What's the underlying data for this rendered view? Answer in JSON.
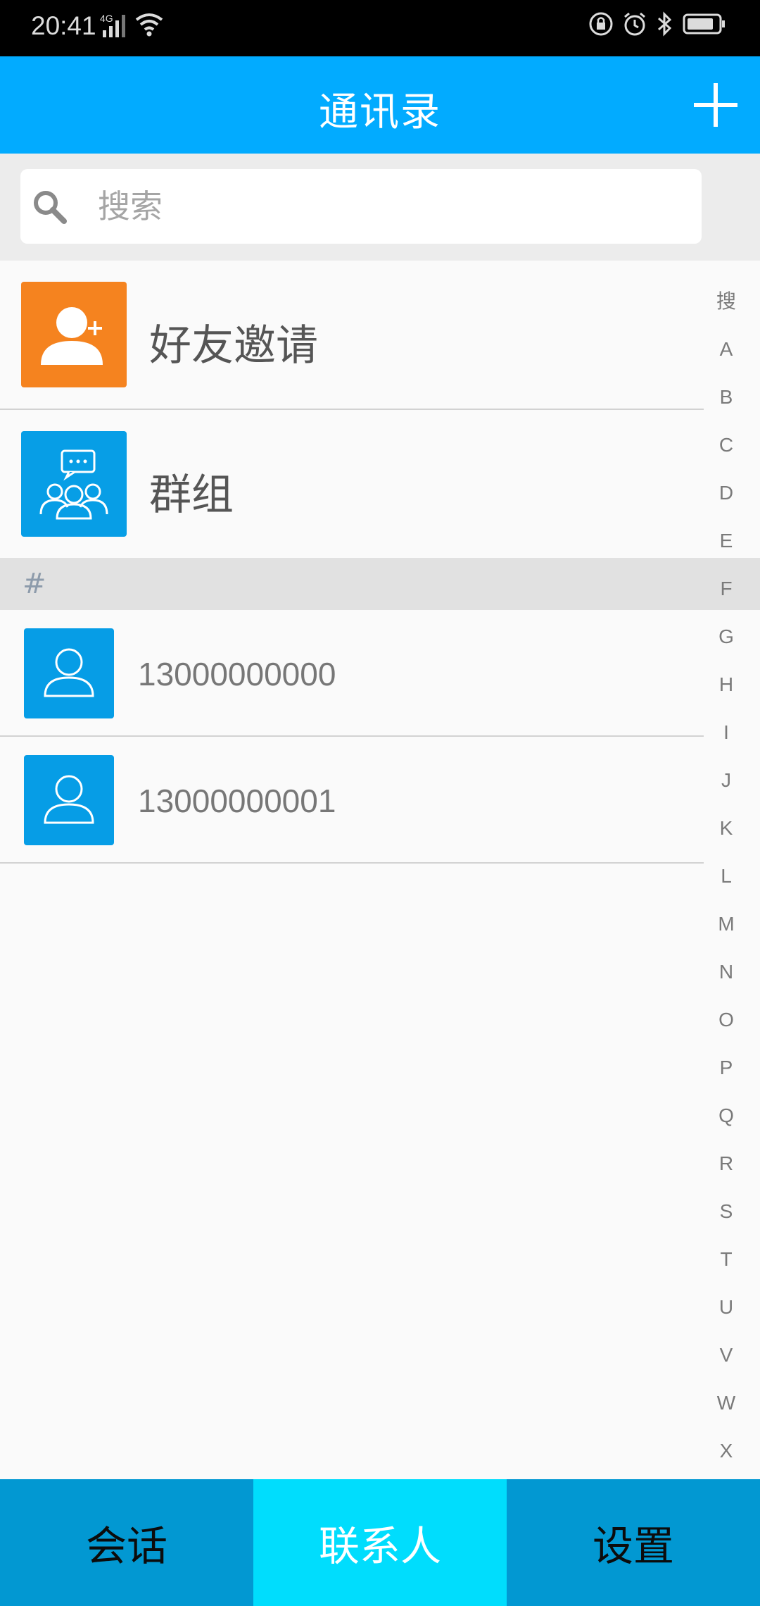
{
  "status_bar": {
    "time": "20:41",
    "network": "4G",
    "icons": [
      "signal-icon",
      "wifi-icon",
      "lock-rotation-icon",
      "alarm-icon",
      "bluetooth-icon",
      "battery-icon"
    ]
  },
  "header": {
    "title": "通讯录",
    "add_icon": "plus-icon"
  },
  "search": {
    "placeholder": "搜索",
    "value": ""
  },
  "special_items": [
    {
      "label": "好友邀请",
      "icon": "add-friend-icon",
      "color": "#f5831f"
    },
    {
      "label": "群组",
      "icon": "group-icon",
      "color": "#079ee6"
    }
  ],
  "section": {
    "letter": "#"
  },
  "contacts": [
    {
      "name": "13000000000",
      "icon": "person-icon"
    },
    {
      "name": "13000000001",
      "icon": "person-icon"
    }
  ],
  "index_bar": [
    "搜",
    "A",
    "B",
    "C",
    "D",
    "E",
    "F",
    "G",
    "H",
    "I",
    "J",
    "K",
    "L",
    "M",
    "N",
    "O",
    "P",
    "Q",
    "R",
    "S",
    "T",
    "U",
    "V",
    "W",
    "X"
  ],
  "bottom_nav": {
    "tabs": [
      {
        "label": "会话",
        "active": false
      },
      {
        "label": "联系人",
        "active": true
      },
      {
        "label": "设置",
        "active": false
      }
    ]
  },
  "colors": {
    "primary": "#02abff",
    "nav_bg": "#0298d2",
    "nav_active": "#00ddfd",
    "section_bg": "#e1e1e1"
  }
}
